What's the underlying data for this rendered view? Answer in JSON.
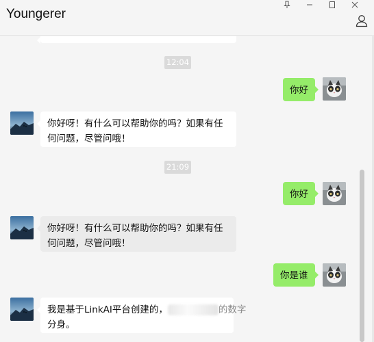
{
  "window": {
    "title": "Youngerer",
    "controls": {
      "pin": "pin-icon",
      "minimize": "minimize-icon",
      "maximize": "maximize-icon",
      "close": "close-icon",
      "profile": "person-icon"
    }
  },
  "messages": [
    {
      "type": "time",
      "text": "12:04"
    },
    {
      "type": "outgoing",
      "text": "你好"
    },
    {
      "type": "incoming",
      "lines": [
        "你好呀！有什么可以帮助你的吗？如果有任",
        "何问题，尽管问哦！"
      ]
    },
    {
      "type": "time",
      "text": "21:09"
    },
    {
      "type": "outgoing",
      "text": "你好"
    },
    {
      "type": "incoming",
      "lines": [
        "你好呀！有什么可以帮助你的吗？如果有任",
        "何问题，尽管问哦！"
      ]
    },
    {
      "type": "outgoing",
      "text": "你是谁"
    },
    {
      "type": "incoming",
      "lines": [
        "我是基于LinkAI平台创建的，",
        "分身。"
      ],
      "partial_visible": "的数字"
    }
  ],
  "colors": {
    "background": "#f5f5f5",
    "outgoing_bubble": "#95ec69",
    "incoming_bubble": "#ffffff",
    "time_badge": "#dadada"
  }
}
